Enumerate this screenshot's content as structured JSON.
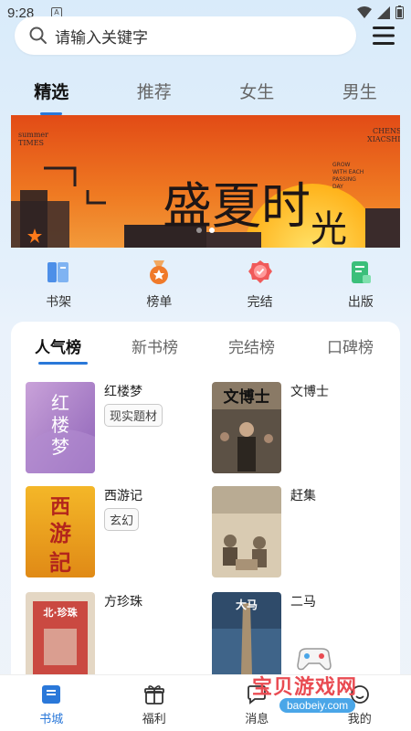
{
  "status": {
    "time": "9:28",
    "small_badge": "A"
  },
  "search": {
    "placeholder": "请输入关键字"
  },
  "top_tabs": [
    {
      "label": "精选",
      "active": true
    },
    {
      "label": "推荐",
      "active": false
    },
    {
      "label": "女生",
      "active": false
    },
    {
      "label": "男生",
      "active": false
    }
  ],
  "banner": {
    "headline_1": "盛夏时",
    "headline_2": "光",
    "left_top_1": "summer",
    "left_top_2": "TIMES",
    "right_top_1": "CHENS",
    "right_top_2": "XIACSHIGU",
    "mid_lines": [
      "GROW",
      "WITH EACH",
      "PASSING",
      "DAY"
    ],
    "dot_count": 2,
    "active_dot": 1
  },
  "quick": [
    {
      "label": "书架",
      "icon": "bookshelf-icon"
    },
    {
      "label": "榜单",
      "icon": "ranking-medal-icon"
    },
    {
      "label": "完结",
      "icon": "finished-badge-icon"
    },
    {
      "label": "出版",
      "icon": "publish-book-icon"
    }
  ],
  "rank_tabs": [
    {
      "label": "人气榜",
      "active": true
    },
    {
      "label": "新书榜",
      "active": false
    },
    {
      "label": "完结榜",
      "active": false
    },
    {
      "label": "口碑榜",
      "active": false
    }
  ],
  "books": [
    {
      "title": "红楼梦",
      "tag": "现实题材",
      "cover_text": "红楼梦"
    },
    {
      "title": "文博士",
      "tag": "",
      "cover_text": "文博士"
    },
    {
      "title": "西游记",
      "tag": "玄幻",
      "cover_text": "西游記"
    },
    {
      "title": "赶集",
      "tag": "",
      "cover_text": ""
    },
    {
      "title": "方珍珠",
      "tag": "",
      "cover_text": "北·珍珠"
    },
    {
      "title": "二马",
      "tag": "",
      "cover_text": "大马"
    }
  ],
  "bottom_nav": [
    {
      "label": "书城",
      "active": true,
      "icon": "book-city-icon"
    },
    {
      "label": "福利",
      "active": false,
      "icon": "gift-icon"
    },
    {
      "label": "消息",
      "active": false,
      "icon": "message-icon"
    },
    {
      "label": "我的",
      "active": false,
      "icon": "profile-icon"
    }
  ],
  "watermark": {
    "text": "宝贝游戏网",
    "url": "baobeiy.com"
  },
  "colors": {
    "accent": "#2a78d9",
    "banner_orange": "#e86a1f"
  }
}
